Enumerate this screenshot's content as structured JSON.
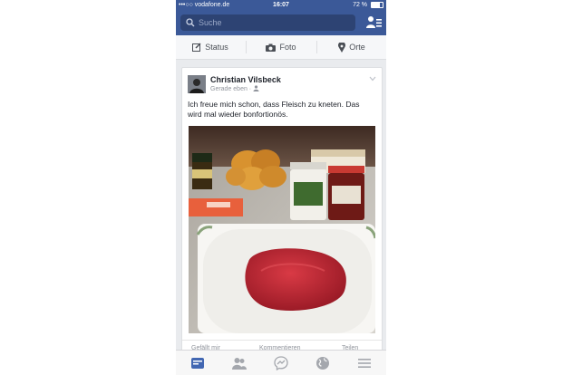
{
  "status_bar": {
    "carrier": "•••○○ vodafone.de",
    "time": "16:07",
    "battery": "72 %",
    "battery_level": 0.72
  },
  "header": {
    "search_placeholder": "Suche"
  },
  "composer": {
    "status_label": "Status",
    "photo_label": "Foto",
    "places_label": "Orte"
  },
  "post": {
    "author": "Christian Vilsbeck",
    "meta": "Gerade eben ·",
    "text": "Ich freue mich schon, dass Fleisch zu kneten. Das wird mal wieder bonfortionös.",
    "actions": {
      "like": "Gefällt mir",
      "comment": "Kommentieren",
      "share": "Teilen"
    }
  },
  "colors": {
    "brand": "#3b5998",
    "background": "#e9ebee",
    "active_tab": "#4267b2",
    "inactive_tab": "#a4a7ad"
  },
  "tab_bar": {
    "active": "news-feed",
    "icons": [
      "news-feed-icon",
      "friends-icon",
      "messenger-icon",
      "globe-icon",
      "menu-icon"
    ]
  }
}
